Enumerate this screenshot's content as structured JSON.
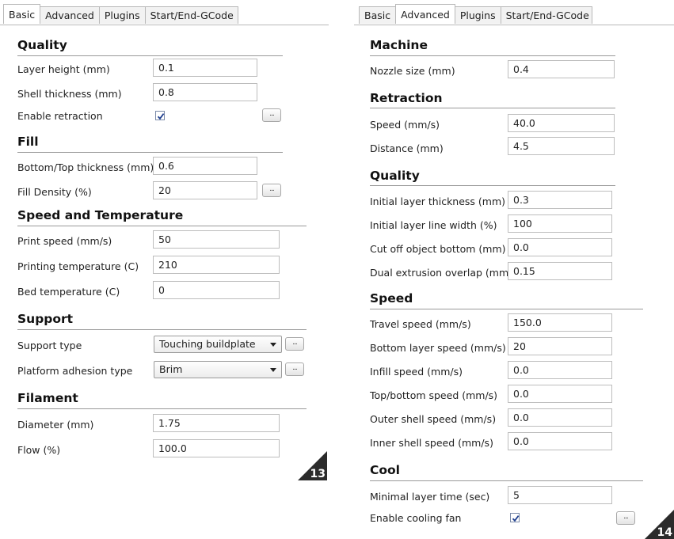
{
  "left": {
    "tabs": [
      "Basic",
      "Advanced",
      "Plugins",
      "Start/End-GCode"
    ],
    "sections": {
      "quality": "Quality",
      "fill": "Fill",
      "speed_temp": "Speed and Temperature",
      "support": "Support",
      "filament": "Filament"
    },
    "fields": {
      "layer_height": {
        "label": "Layer height (mm)",
        "value": "0.1"
      },
      "shell_thickness": {
        "label": "Shell thickness (mm)",
        "value": "0.8"
      },
      "enable_retraction": {
        "label": "Enable retraction"
      },
      "bottom_top_thickness": {
        "label": "Bottom/Top thickness (mm)",
        "value": "0.6"
      },
      "fill_density": {
        "label": "Fill Density (%)",
        "value": "20"
      },
      "print_speed": {
        "label": "Print speed (mm/s)",
        "value": "50"
      },
      "printing_temp": {
        "label": "Printing temperature (C)",
        "value": "210"
      },
      "bed_temp": {
        "label": "Bed temperature (C)",
        "value": "0"
      },
      "support_type": {
        "label": "Support type",
        "value": "Touching buildplate"
      },
      "platform_adhesion": {
        "label": "Platform adhesion type",
        "value": "Brim"
      },
      "diameter": {
        "label": "Diameter (mm)",
        "value": "1.75"
      },
      "flow": {
        "label": "Flow (%)",
        "value": "100.0"
      }
    },
    "dots_label": "...",
    "page_number": "13"
  },
  "right": {
    "tabs": [
      "Basic",
      "Advanced",
      "Plugins",
      "Start/End-GCode"
    ],
    "sections": {
      "machine": "Machine",
      "retraction": "Retraction",
      "quality": "Quality",
      "speed": "Speed",
      "cool": "Cool"
    },
    "fields": {
      "nozzle_size": {
        "label": "Nozzle size (mm)",
        "value": "0.4"
      },
      "retraction_speed": {
        "label": "Speed (mm/s)",
        "value": "40.0"
      },
      "retraction_distance": {
        "label": "Distance (mm)",
        "value": "4.5"
      },
      "initial_layer_thickness": {
        "label": "Initial layer thickness (mm)",
        "value": "0.3"
      },
      "initial_layer_line_width": {
        "label": "Initial layer line width (%)",
        "value": "100"
      },
      "cut_off_bottom": {
        "label": "Cut off object bottom (mm)",
        "value": "0.0"
      },
      "dual_extrusion_overlap": {
        "label": "Dual extrusion overlap (mm)",
        "value": "0.15"
      },
      "travel_speed": {
        "label": "Travel speed (mm/s)",
        "value": "150.0"
      },
      "bottom_layer_speed": {
        "label": "Bottom layer speed (mm/s)",
        "value": "20"
      },
      "infill_speed": {
        "label": "Infill speed (mm/s)",
        "value": "0.0"
      },
      "top_bottom_speed": {
        "label": "Top/bottom speed (mm/s)",
        "value": "0.0"
      },
      "outer_shell_speed": {
        "label": "Outer shell speed (mm/s)",
        "value": "0.0"
      },
      "inner_shell_speed": {
        "label": "Inner shell speed (mm/s)",
        "value": "0.0"
      },
      "minimal_layer_time": {
        "label": "Minimal layer time (sec)",
        "value": "5"
      },
      "enable_cooling_fan": {
        "label": "Enable cooling fan"
      }
    },
    "dots_label": "...",
    "page_number": "14"
  },
  "colors": {
    "corner_badge": "#2b2b2b",
    "tab_border": "#b8b8b8",
    "checkmark": "#1f3f8f"
  }
}
